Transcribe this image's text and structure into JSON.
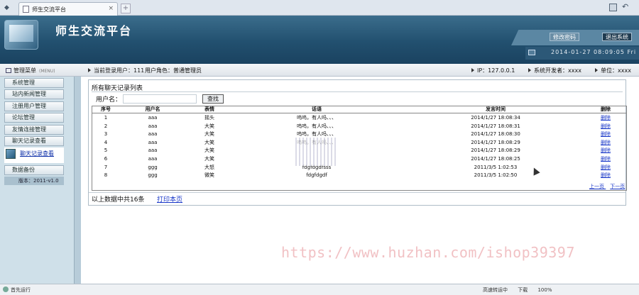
{
  "browser": {
    "tab_title": "师生交流平台",
    "tab_close": "×",
    "new_tab": "+"
  },
  "header": {
    "title": "师生交流平台",
    "change_password": "修改密码",
    "logout": "退出系统",
    "datetime": "2014-01-27 08:09:05 Fri"
  },
  "infobar": {
    "menu_title": "管理菜单",
    "menu_sub": "(MENU)",
    "current_user": "当前登录用户：111",
    "user_role": "用户角色：普通管理员",
    "ip": "IP：127.0.0.1",
    "developer": "系统开发者：xxxx",
    "unit": "单位：xxxx"
  },
  "sidebar": {
    "items": [
      {
        "label": "系统管理"
      },
      {
        "label": "站内新闻管理"
      },
      {
        "label": "注册用户管理"
      },
      {
        "label": "论坛管理"
      },
      {
        "label": "友情连接管理"
      },
      {
        "label": "聊天记录查看"
      },
      {
        "label": "聊天记录查看"
      },
      {
        "label": "数据备份"
      }
    ],
    "version": "版本：2011-v1.0"
  },
  "main": {
    "caption": "所有聊天记录列表",
    "search_label": "用户名：",
    "search_value": "",
    "search_button": "查找",
    "columns": [
      "序号",
      "用户名",
      "表情",
      "话语",
      "发言时间",
      "删除"
    ],
    "rows": [
      {
        "no": "1",
        "user": "aaa",
        "face": "摇头",
        "msg": "呜呜，有人吗、、、",
        "time": "2014/1/27 18:08:34",
        "del": "删除"
      },
      {
        "no": "2",
        "user": "aaa",
        "face": "大笑",
        "msg": "呜呜，有人吗、、、",
        "time": "2014/1/27 18:08:31",
        "del": "删除"
      },
      {
        "no": "3",
        "user": "aaa",
        "face": "大笑",
        "msg": "呜呜，有人吗、、、",
        "time": "2014/1/27 18:08:30",
        "del": "删除"
      },
      {
        "no": "4",
        "user": "aaa",
        "face": "大笑",
        "msg": "呜呜，有人吗、、、",
        "time": "2014/1/27 18:08:29",
        "del": "删除"
      },
      {
        "no": "5",
        "user": "aaa",
        "face": "大笑",
        "msg": "",
        "time": "2014/1/27 18:08:29",
        "del": "删除"
      },
      {
        "no": "6",
        "user": "aaa",
        "face": "大笑",
        "msg": "",
        "time": "2014/1/27 18:08:25",
        "del": "删除"
      },
      {
        "no": "7",
        "user": "ggg",
        "face": "大怒",
        "msg": "fdgfdgdfsss",
        "time": "2011/3/5 1:02:53",
        "del": "删除"
      },
      {
        "no": "8",
        "user": "ggg",
        "face": "微笑",
        "msg": "fdgfdgdf",
        "time": "2011/3/5 1:02:50",
        "del": "删除"
      }
    ],
    "prev_page": "上一页",
    "next_page": "下一页",
    "footer_text": "以上数据中共16条",
    "print_link": "打印本页"
  },
  "watermark": "https://www.huzhan.com/ishop39397",
  "statusbar": {
    "left": "首先运行",
    "items": [
      "高速转运中",
      "下载",
      "100%"
    ]
  }
}
